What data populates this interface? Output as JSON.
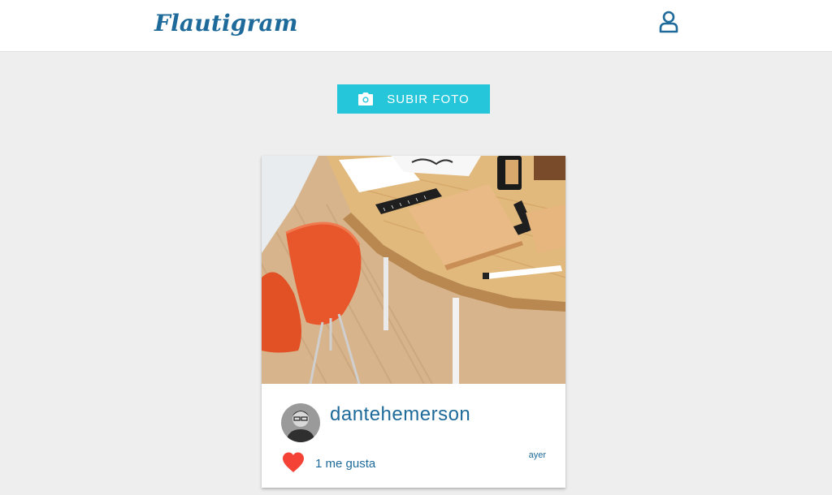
{
  "app": {
    "brand": "Flautigram"
  },
  "header": {
    "user_icon": "user-icon"
  },
  "actions": {
    "upload_label": "SUBIR FOTO",
    "upload_icon": "camera-icon"
  },
  "post": {
    "photo_icon": "desk-photo",
    "username": "dantehemerson",
    "time": "ayer",
    "likes_text": "1 me gusta",
    "like_icon": "heart-icon"
  },
  "colors": {
    "brand": "#1e6a9a",
    "accent": "#26c6da",
    "heart": "#f44336",
    "background": "#eeeeee"
  }
}
